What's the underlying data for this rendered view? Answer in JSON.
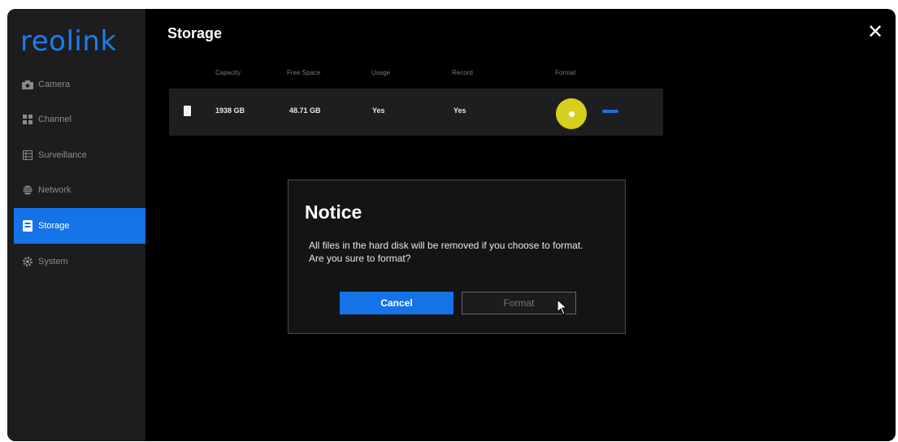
{
  "app": {
    "logo": "reolink"
  },
  "sidebar": {
    "items": [
      {
        "label": "Camera",
        "icon": "camera-icon",
        "active": false
      },
      {
        "label": "Channel",
        "icon": "channel-icon",
        "active": false
      },
      {
        "label": "Surveillance",
        "icon": "surveillance-icon",
        "active": false
      },
      {
        "label": "Network",
        "icon": "network-icon",
        "active": false
      },
      {
        "label": "Storage",
        "icon": "storage-icon",
        "active": true
      },
      {
        "label": "System",
        "icon": "gear-icon",
        "active": false
      }
    ]
  },
  "main": {
    "title": "Storage",
    "close_icon": "close-icon",
    "table": {
      "headers": [
        "Capacity",
        "Free Space",
        "Usage",
        "Record",
        "Format"
      ],
      "rows": [
        {
          "icon": "hard-disk-icon",
          "capacity": "1938 GB",
          "free_space": "48.71 GB",
          "usage": "Yes",
          "record": "Yes"
        }
      ]
    }
  },
  "dialog": {
    "title": "Notice",
    "message": "All files in the hard disk will be removed if you choose to format. Are you sure to format?",
    "cancel_label": "Cancel",
    "format_label": "Format"
  },
  "colors": {
    "accent": "#1473e6",
    "highlight": "#d6d01c",
    "background": "#000000",
    "sidebar": "#1d1d1f"
  }
}
